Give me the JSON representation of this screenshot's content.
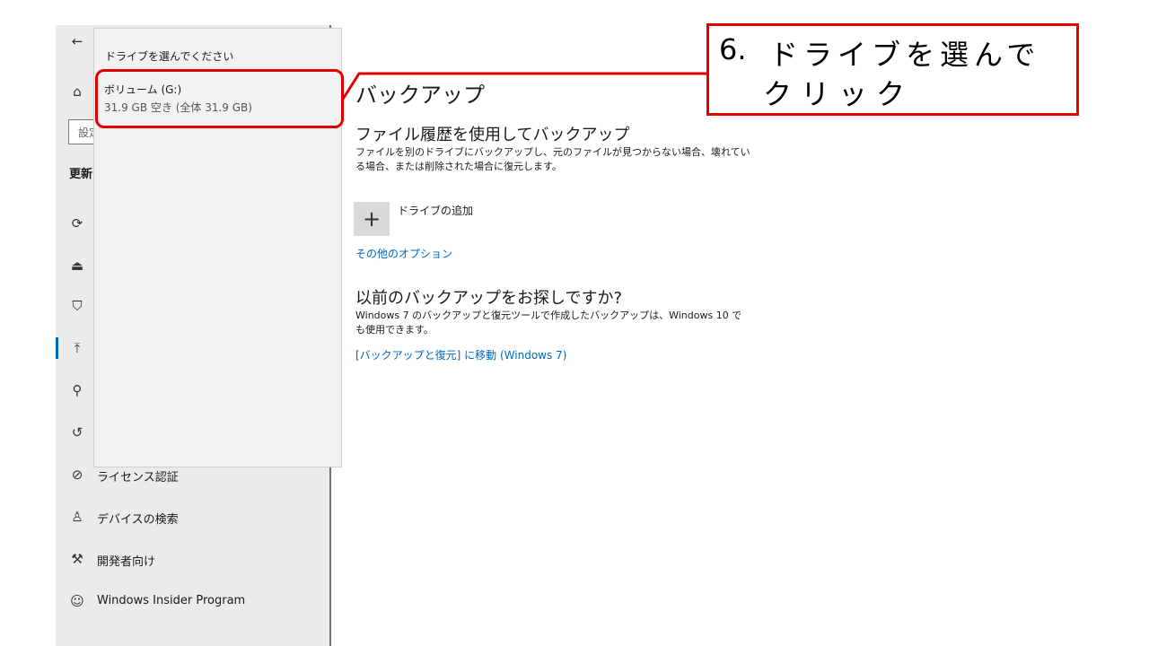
{
  "sidebar": {
    "back_icon": "back-arrow-icon",
    "search_placeholder": "設定",
    "section_title": "更新",
    "items": [
      {
        "icon": "home-icon",
        "label": ""
      },
      {
        "icon": "sync-icon",
        "label": ""
      },
      {
        "icon": "delivery-icon",
        "label": ""
      },
      {
        "icon": "shield-icon",
        "label": ""
      },
      {
        "icon": "backup-icon",
        "label": ""
      },
      {
        "icon": "wrench-icon",
        "label": ""
      },
      {
        "icon": "history-icon",
        "label": ""
      },
      {
        "icon": "check-circle-icon",
        "label": "ライセンス認証"
      },
      {
        "icon": "person-pin-icon",
        "label": "デバイスの検索"
      },
      {
        "icon": "tools-icon",
        "label": "開発者向け"
      },
      {
        "icon": "insider-cat-icon",
        "label": "Windows Insider Program"
      }
    ]
  },
  "flyout": {
    "title": "ドライブを選んでください",
    "drive_name": "ボリューム (G:)",
    "drive_free": "31.9 GB 空き (全体 31.9 GB)"
  },
  "main": {
    "title": "バックアップ",
    "file_history_heading": "ファイル履歴を使用してバックアップ",
    "file_history_desc": "ファイルを別のドライブにバックアップし、元のファイルが見つからない場合、壊れている場合、または削除された場合に復元します。",
    "add_drive_label": "ドライブの追加",
    "other_options_link": "その他のオプション",
    "old_backup_heading": "以前のバックアップをお探しですか?",
    "old_backup_desc": "Windows 7 のバックアップと復元ツールで作成したバックアップは、Windows 10 でも使用できます。",
    "win7_link": "[バックアップと復元] に移動 (Windows 7)"
  },
  "annotation": {
    "step_number": "6.",
    "line1": "ドライブを選んで",
    "line2": "クリック",
    "color": "#e00000"
  }
}
